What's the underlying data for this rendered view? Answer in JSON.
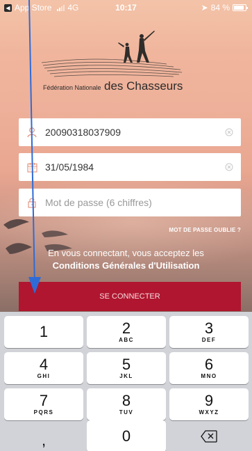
{
  "status_bar": {
    "back_app": "App Store",
    "network": "4G",
    "time": "10:17",
    "battery": "84 %"
  },
  "logo": {
    "prefix": "Fédération Nationale",
    "name": "des Chasseurs"
  },
  "form": {
    "identifier_value": "20090318037909",
    "birthdate_value": "31/05/1984",
    "password_placeholder": "Mot de passe (6 chiffres)",
    "forgot_label": "MOT DE PASSE OUBLIE ?",
    "consent_line1": "En vous connectant, vous acceptez les",
    "consent_link": "Conditions Générales d'Utilisation",
    "submit_label": "SE CONNECTER"
  },
  "keyboard": {
    "keys": [
      {
        "num": "1",
        "letters": ""
      },
      {
        "num": "2",
        "letters": "ABC"
      },
      {
        "num": "3",
        "letters": "DEF"
      },
      {
        "num": "4",
        "letters": "GHI"
      },
      {
        "num": "5",
        "letters": "JKL"
      },
      {
        "num": "6",
        "letters": "MNO"
      },
      {
        "num": "7",
        "letters": "PQRS"
      },
      {
        "num": "8",
        "letters": "TUV"
      },
      {
        "num": "9",
        "letters": "WXYZ"
      },
      {
        "num": ",",
        "letters": ""
      },
      {
        "num": "0",
        "letters": ""
      }
    ]
  },
  "colors": {
    "accent_red": "#b0162f",
    "annotation_arrow": "#2f6bd6"
  }
}
